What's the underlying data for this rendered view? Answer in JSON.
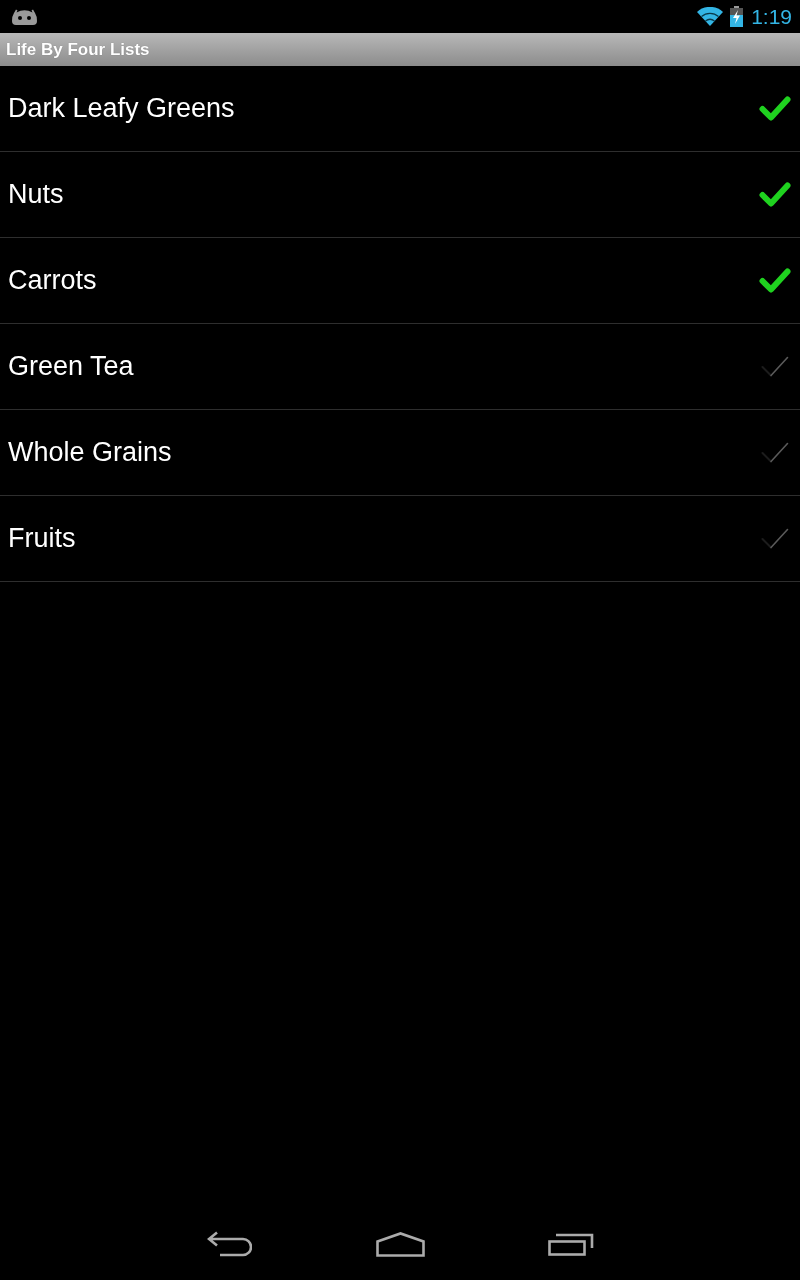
{
  "status_bar": {
    "time": "1:19"
  },
  "title_bar": {
    "title": "Life By Four Lists"
  },
  "items": [
    {
      "label": "Dark Leafy Greens",
      "checked": true
    },
    {
      "label": "Nuts",
      "checked": true
    },
    {
      "label": "Carrots",
      "checked": true
    },
    {
      "label": "Green Tea",
      "checked": false
    },
    {
      "label": "Whole Grains",
      "checked": false
    },
    {
      "label": "Fruits",
      "checked": false
    }
  ]
}
